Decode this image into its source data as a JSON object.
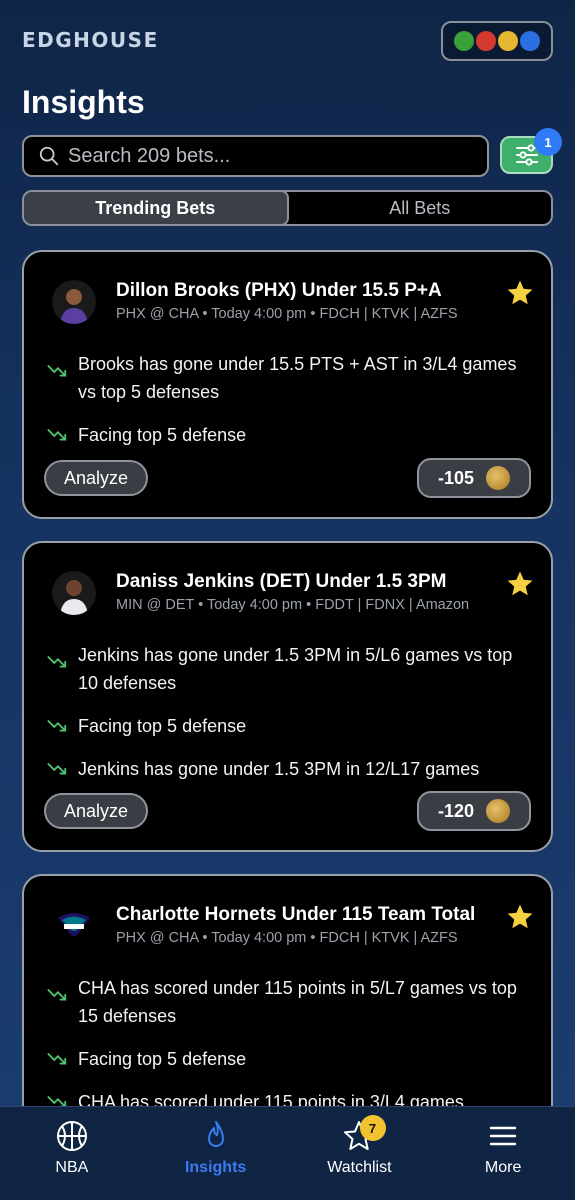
{
  "app": {
    "brand": "EDGHOUSE",
    "page_title": "Insights"
  },
  "search": {
    "placeholder": "Search 209 bets..."
  },
  "filter": {
    "badge_count": "1"
  },
  "segments": [
    {
      "label": "Trending Bets",
      "active": true
    },
    {
      "label": "All Bets",
      "active": false
    }
  ],
  "cards": [
    {
      "title": "Dillon Brooks (PHX) Under 15.5 P+A",
      "subtitle": "PHX @ CHA • Today 4:00 pm • FDCH | KTVK | AZFS",
      "insights": [
        "Brooks has gone under 15.5 PTS + AST in 3/L4 games vs top 5 defenses",
        "Facing top 5 defense"
      ],
      "analyze_label": "Analyze",
      "odds": "-105"
    },
    {
      "title": "Daniss Jenkins (DET) Under 1.5 3PM",
      "subtitle": "MIN @ DET • Today 4:00 pm • FDDT | FDNX | Amazon",
      "insights": [
        "Jenkins has gone under 1.5 3PM in 5/L6 games vs top 10 defenses",
        "Facing top 5 defense",
        "Jenkins has gone under 1.5 3PM in 12/L17 games"
      ],
      "analyze_label": "Analyze",
      "odds": "-120"
    },
    {
      "title": "Charlotte Hornets Under 115 Team Total",
      "subtitle": "PHX @ CHA • Today 4:00 pm • FDCH | KTVK | AZFS",
      "insights": [
        "CHA has scored under 115 points in 5/L7 games vs top 15 defenses",
        "Facing top 5 defense",
        "CHA has scored under 115 points in 3/L4 games"
      ]
    }
  ],
  "tabbar": [
    {
      "label": "NBA",
      "icon": "basketball-icon",
      "active": false
    },
    {
      "label": "Insights",
      "icon": "flame-icon",
      "active": true
    },
    {
      "label": "Watchlist",
      "icon": "star-outline-icon",
      "active": false,
      "badge": "7"
    },
    {
      "label": "More",
      "icon": "menu-icon",
      "active": false
    }
  ],
  "colors": {
    "accent_blue": "#3a7cf0",
    "filter_green": "#3fb06b",
    "star_yellow": "#f5d142",
    "trend_green": "#4ec46f"
  }
}
